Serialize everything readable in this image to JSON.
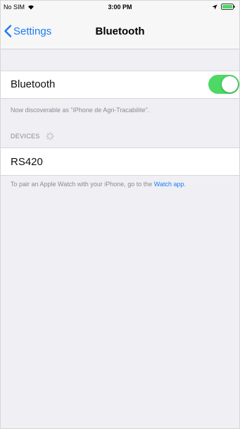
{
  "status_bar": {
    "carrier": "No SIM",
    "time": "3:00 PM",
    "battery_color": "#4cd964"
  },
  "nav": {
    "back_label": "Settings",
    "title": "Bluetooth"
  },
  "bluetooth": {
    "label": "Bluetooth",
    "enabled": true,
    "toggle_color": "#4cd964",
    "discoverable_text": "Now discoverable as \"iPhone de Agri-Tracabilite\"."
  },
  "devices": {
    "header": "DEVICES",
    "items": [
      {
        "name": "RS420"
      }
    ]
  },
  "footer": {
    "text": "To pair an Apple Watch with your iPhone, go to the ",
    "link": "Watch app",
    "end": "."
  },
  "accent_color": "#1a7cf6"
}
